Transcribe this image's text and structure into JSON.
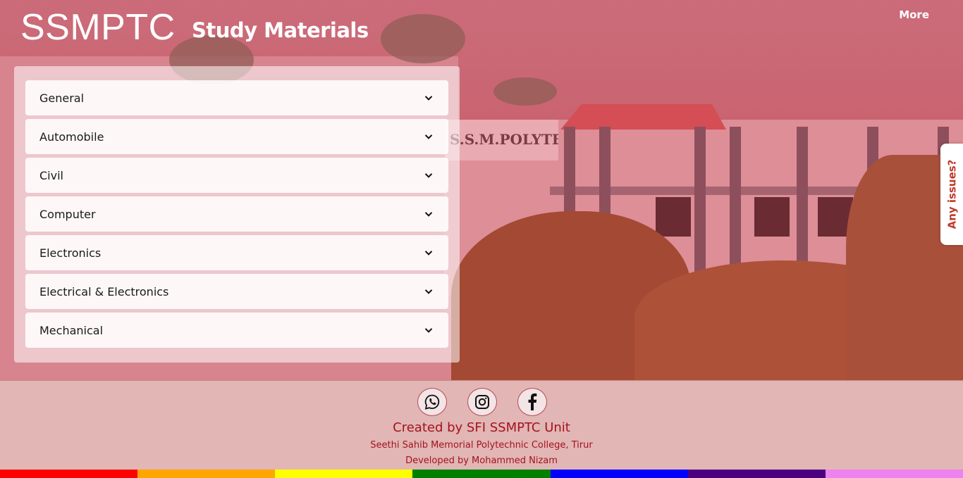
{
  "header": {
    "logo": "SSMPTC",
    "subtitle": "Study Materials",
    "more_label": "More"
  },
  "background": {
    "sign_text": "S.S.M.POLYTECHNIC"
  },
  "departments": [
    {
      "label": "General"
    },
    {
      "label": "Automobile"
    },
    {
      "label": "Civil"
    },
    {
      "label": "Computer"
    },
    {
      "label": "Electronics"
    },
    {
      "label": "Electrical & Electronics"
    },
    {
      "label": "Mechanical"
    }
  ],
  "side_tab": {
    "label": "Any issues?"
  },
  "footer": {
    "socials": [
      "whatsapp-icon",
      "instagram-icon",
      "facebook-icon"
    ],
    "created": "Created by SFI SSMPTC Unit",
    "college": "Seethi Sahib Memorial Polytechnic College, Tirur",
    "developer": "Developed by Mohammed Nizam"
  },
  "colors": {
    "accent": "#a5121f",
    "rainbow": [
      "#ff0000",
      "#ffa500",
      "#ffff00",
      "#008000",
      "#0000ff",
      "#4b0082",
      "#ee82ee"
    ]
  }
}
